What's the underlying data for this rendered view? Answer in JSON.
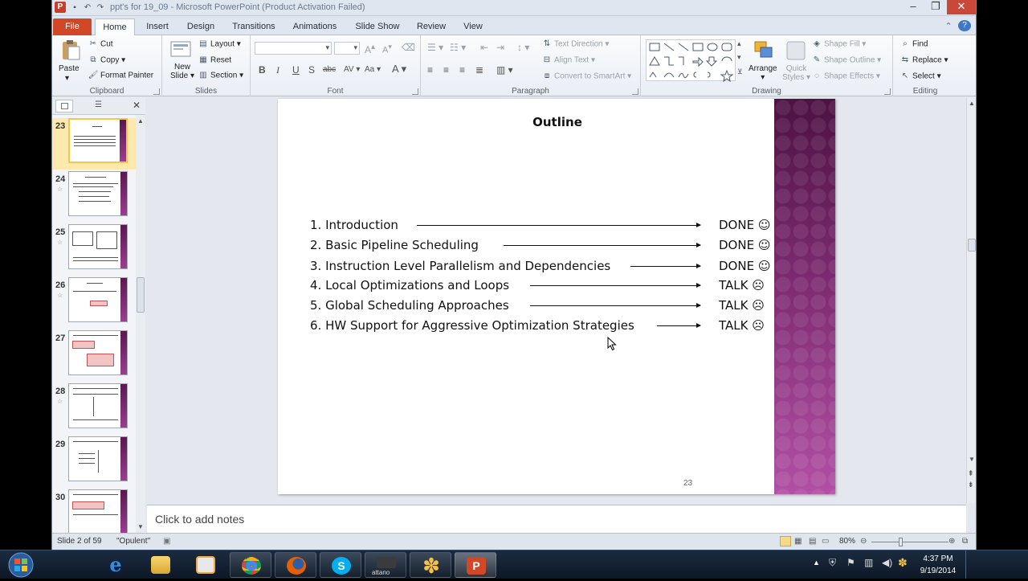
{
  "window": {
    "title": "ppt's for 19_09 - Microsoft PowerPoint (Product Activation Failed)",
    "min": "–",
    "max": "❐",
    "close": "✕"
  },
  "tabs": [
    "File",
    "Home",
    "Insert",
    "Design",
    "Transitions",
    "Animations",
    "Slide Show",
    "Review",
    "View"
  ],
  "ribbon": {
    "clipboard": {
      "paste": "Paste",
      "cut": "Cut",
      "copy": "Copy",
      "format_painter": "Format Painter",
      "label": "Clipboard"
    },
    "slides": {
      "new_slide": "New",
      "new_slide2": "Slide",
      "layout": "Layout",
      "reset": "Reset",
      "section": "Section",
      "label": "Slides"
    },
    "font": {
      "label": "Font"
    },
    "paragraph": {
      "text_direction": "Text Direction",
      "align_text": "Align Text",
      "convert_smartart": "Convert to SmartArt",
      "label": "Paragraph"
    },
    "drawing": {
      "arrange": "Arrange",
      "quick_styles": "Quick",
      "quick_styles2": "Styles",
      "shape_fill": "Shape Fill",
      "shape_outline": "Shape Outline",
      "shape_effects": "Shape Effects",
      "label": "Drawing"
    },
    "editing": {
      "find": "Find",
      "replace": "Replace",
      "select": "Select",
      "label": "Editing"
    }
  },
  "thumbnails": [
    {
      "num": "23",
      "star": ""
    },
    {
      "num": "24",
      "star": "☆"
    },
    {
      "num": "25",
      "star": "☆"
    },
    {
      "num": "26",
      "star": "☆"
    },
    {
      "num": "27",
      "star": "☆"
    },
    {
      "num": "28",
      "star": "☆"
    },
    {
      "num": "29",
      "star": ""
    },
    {
      "num": "30",
      "star": ""
    }
  ],
  "slide": {
    "title": "Outline",
    "items": [
      {
        "text": "1. Introduction",
        "status": "DONE ☺"
      },
      {
        "text": "2. Basic Pipeline Scheduling",
        "status": "DONE ☺"
      },
      {
        "text": "3. Instruction Level Parallelism and Dependencies",
        "status": "DONE ☺"
      },
      {
        "text": "4. Local Optimizations and Loops",
        "status": "TALK ☹"
      },
      {
        "text": "5. Global Scheduling Approaches",
        "status": "TALK ☹"
      },
      {
        "text": "6. HW Support for Aggressive Optimization Strategies",
        "status": "TALK ☹"
      }
    ],
    "number": "23"
  },
  "notes_placeholder": "Click to add notes",
  "status": {
    "slide_of": "Slide 2 of 59",
    "theme": "\"Opulent\"",
    "zoom": "80%"
  },
  "taskbar": {
    "time": "4:37 PM",
    "date": "9/19/2014",
    "apps": [
      "internet-explorer",
      "file-explorer",
      "media-player",
      "chrome",
      "firefox",
      "skype",
      "attano",
      "pinwheel-app",
      "powerpoint"
    ],
    "app_label_attano": "attano"
  }
}
